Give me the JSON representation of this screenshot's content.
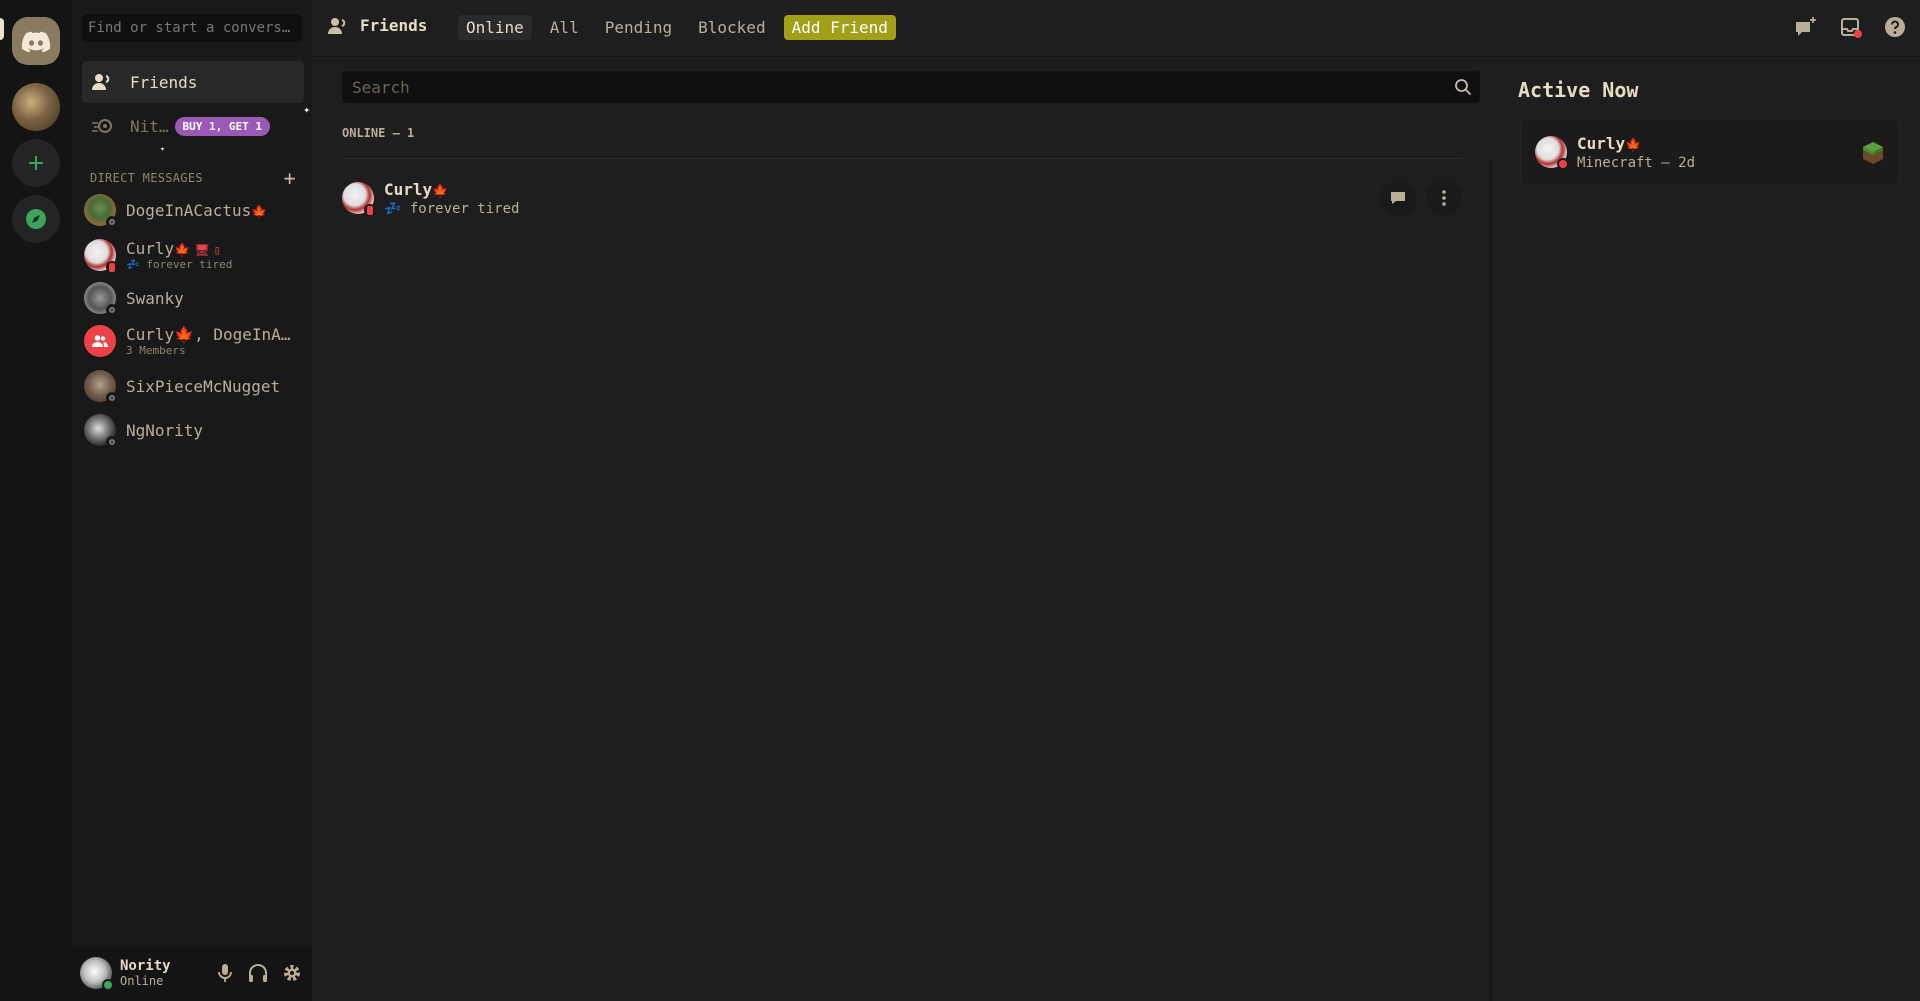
{
  "colors": {
    "accent": "#a29f1a",
    "nitro": "#9b59b6",
    "online": "#3ba55c",
    "dnd": "#ed4245",
    "leaf": "#e25a1c"
  },
  "sidebar": {
    "search_placeholder": "Find or start a convers…",
    "friends_label": "Friends",
    "nitro_label": "Nit…",
    "nitro_badge": "BUY 1, GET 1",
    "dm_header": "DIRECT MESSAGES",
    "dms": [
      {
        "name": "DogeInACactus",
        "emoji": "🍁",
        "status": "offline"
      },
      {
        "name": "Curly",
        "emoji": "🍁",
        "sub": "forever tired",
        "sub_emoji": "💤",
        "status": "mobile"
      },
      {
        "name": "Swanky",
        "status": "offline"
      },
      {
        "name": "Curly🍁, DogeInA…",
        "sub": "3 Members",
        "group": true
      },
      {
        "name": "SixPieceMcNugget",
        "status": "offline"
      },
      {
        "name": "NgNority",
        "status": "offline"
      }
    ]
  },
  "user": {
    "name": "Nority",
    "status": "Online"
  },
  "topbar": {
    "title": "Friends",
    "tabs": [
      "Online",
      "All",
      "Pending",
      "Blocked"
    ],
    "add_friend": "Add Friend"
  },
  "main": {
    "search_placeholder": "Search",
    "online_header": "ONLINE — 1",
    "friends": [
      {
        "name": "Curly",
        "emoji": "🍁",
        "status_emoji": "💤",
        "status_text": "forever tired"
      }
    ]
  },
  "active_now": {
    "title": "Active Now",
    "cards": [
      {
        "name": "Curly",
        "emoji": "🍁",
        "activity": "Minecraft — 2d"
      }
    ]
  }
}
